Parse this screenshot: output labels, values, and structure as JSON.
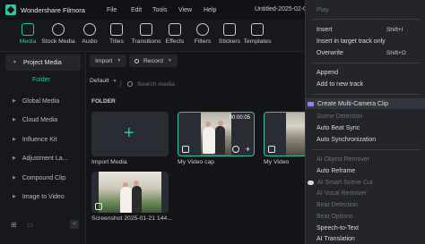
{
  "window": {
    "app_name": "Wondershare Filmora",
    "menu": [
      "File",
      "Edit",
      "Tools",
      "View",
      "Help"
    ],
    "doc_title": "Untitled-2025-02-0"
  },
  "toolbar": {
    "tools": [
      {
        "label": "Media",
        "icon": "media-icon",
        "active": true
      },
      {
        "label": "Stock Media",
        "icon": "stock-media-icon"
      },
      {
        "label": "Audio",
        "icon": "audio-icon"
      },
      {
        "label": "Titles",
        "icon": "titles-icon"
      },
      {
        "label": "Transitions",
        "icon": "transitions-icon"
      },
      {
        "label": "Effects",
        "icon": "effects-icon"
      },
      {
        "label": "Filters",
        "icon": "filters-icon"
      },
      {
        "label": "Stickers",
        "icon": "stickers-icon"
      },
      {
        "label": "Templates",
        "icon": "templates-icon"
      }
    ]
  },
  "sidebar": {
    "items": [
      {
        "label": "Project Media"
      },
      {
        "label": "Global Media"
      },
      {
        "label": "Cloud Media"
      },
      {
        "label": "Influence Kit"
      },
      {
        "label": "Adjustment La..."
      },
      {
        "label": "Compound Clip"
      },
      {
        "label": "Image to Video"
      }
    ],
    "folder_label": "Folder",
    "collapse": "<"
  },
  "main": {
    "import_label": "Import",
    "record_label": "Record",
    "sort_label": "Default",
    "search_placeholder": "Search media",
    "section_label": "FOLDER",
    "cards": [
      {
        "label": "Import Media"
      },
      {
        "label": "My Video cap",
        "duration": "00:00:05"
      },
      {
        "label": "My Video"
      },
      {
        "label": "Screenshot 2025-01-21 144..."
      }
    ]
  },
  "context_menu": {
    "items": [
      {
        "label": "Play",
        "disabled": true
      },
      {
        "label": "Insert",
        "shortcut": "Shift+I"
      },
      {
        "label": "Insert in target track only"
      },
      {
        "label": "Overwrite",
        "shortcut": "Shift+O"
      },
      {
        "label": "Append"
      },
      {
        "label": "Add to new track"
      },
      {
        "label": "Create Multi-Camera Clip",
        "highlight": true
      },
      {
        "label": "Scene Detection",
        "disabled": true
      },
      {
        "label": "Auto Beat Sync"
      },
      {
        "label": "Auto Synchronization"
      },
      {
        "label": "AI Object Remover",
        "disabled": true
      },
      {
        "label": "Auto Reframe"
      },
      {
        "label": "AI Smart Scene Cut",
        "disabled": true
      },
      {
        "label": "AI Vocal Remover",
        "disabled": true
      },
      {
        "label": "Beat Detection",
        "disabled": true
      },
      {
        "label": "Beat Options",
        "disabled": true
      },
      {
        "label": "Speech-to-Text"
      },
      {
        "label": "AI Translation"
      }
    ]
  },
  "colors": {
    "accent": "#2ec4a6",
    "background": "#141519",
    "panel": "#17181c",
    "menu_bg": "#23252b"
  }
}
